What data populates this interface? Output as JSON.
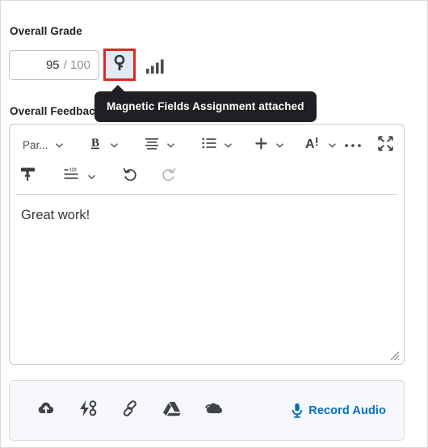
{
  "grade": {
    "label": "Overall Grade",
    "score": "95",
    "out_of": "/ 100",
    "key_icon": "key-icon",
    "stats_icon": "statistics-bar-chart-icon"
  },
  "tooltip": {
    "text": "Magnetic Fields Assignment attached"
  },
  "feedback": {
    "label": "Overall Feedback",
    "body": "Great work!"
  },
  "toolbar": {
    "paragraph_label": "Par...",
    "items": [
      {
        "name": "paragraph-format-dropdown",
        "icon": "text-label"
      },
      {
        "name": "bold-button",
        "icon": "bold-icon"
      },
      {
        "name": "align-button",
        "icon": "align-left-icon"
      },
      {
        "name": "list-button",
        "icon": "bulleted-list-icon"
      },
      {
        "name": "insert-button",
        "icon": "plus-icon"
      },
      {
        "name": "font-style-button",
        "icon": "font-accessibility-icon"
      },
      {
        "name": "more-options-button",
        "icon": "ellipsis-icon"
      },
      {
        "name": "fullscreen-button",
        "icon": "expand-fullscreen-icon"
      },
      {
        "name": "format-painter-button",
        "icon": "format-painter-icon"
      },
      {
        "name": "numbered-list-button",
        "icon": "numbered-list-icon"
      },
      {
        "name": "undo-button",
        "icon": "undo-icon"
      },
      {
        "name": "redo-button",
        "icon": "redo-icon"
      }
    ]
  },
  "attachments": {
    "items": [
      {
        "name": "upload-file-button",
        "icon": "cloud-upload-icon"
      },
      {
        "name": "quicklink-button",
        "icon": "lightning-quicklink-icon"
      },
      {
        "name": "insert-link-button",
        "icon": "link-chain-icon"
      },
      {
        "name": "google-drive-button",
        "icon": "google-drive-icon"
      },
      {
        "name": "onedrive-button",
        "icon": "onedrive-cloud-icon"
      }
    ],
    "record_audio_label": "Record Audio"
  },
  "colors": {
    "highlight_red": "#d92a27",
    "link_blue": "#006fbf",
    "tooltip_bg": "#1f2023",
    "key_btn_bg": "#e4eaf1"
  }
}
